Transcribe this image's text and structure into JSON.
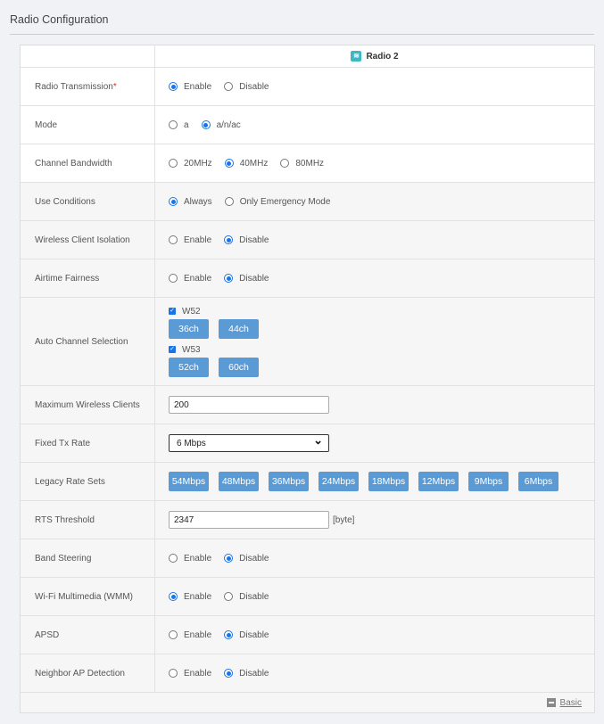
{
  "title": "Radio Configuration",
  "header": {
    "radio": "Radio 2",
    "icon": "wifi-icon",
    "icon_color": "#3bb8c4"
  },
  "rows": [
    {
      "label": "Radio Transmission",
      "required": "*",
      "type": "radio",
      "options": [
        "Enable",
        "Disable"
      ],
      "selected": 0
    },
    {
      "label": "Mode",
      "type": "radio",
      "options": [
        "a",
        "a/n/ac"
      ],
      "selected": 1
    },
    {
      "label": "Channel Bandwidth",
      "type": "radio",
      "options": [
        "20MHz",
        "40MHz",
        "80MHz"
      ],
      "selected": 1
    },
    {
      "label": "Use Conditions",
      "type": "radio",
      "options": [
        "Always",
        "Only Emergency Mode"
      ],
      "selected": 0
    },
    {
      "label": "Wireless Client Isolation",
      "type": "radio",
      "options": [
        "Enable",
        "Disable"
      ],
      "selected": 1
    },
    {
      "label": "Airtime Fairness",
      "type": "radio",
      "options": [
        "Enable",
        "Disable"
      ],
      "selected": 1
    },
    {
      "label": "Auto Channel Selection",
      "type": "channels",
      "groups": [
        {
          "name": "W52",
          "checked": true,
          "channels": [
            "36ch",
            "44ch"
          ]
        },
        {
          "name": "W53",
          "checked": true,
          "channels": [
            "52ch",
            "60ch"
          ]
        }
      ]
    },
    {
      "label": "Maximum Wireless Clients",
      "type": "input",
      "value": "200"
    },
    {
      "label": "Fixed Tx Rate",
      "type": "select",
      "value": "6 Mbps"
    },
    {
      "label": "Legacy Rate Sets",
      "type": "buttons",
      "buttons": [
        "54Mbps",
        "48Mbps",
        "36Mbps",
        "24Mbps",
        "18Mbps",
        "12Mbps",
        "9Mbps",
        "6Mbps"
      ]
    },
    {
      "label": "RTS Threshold",
      "type": "input",
      "value": "2347",
      "unit": "[byte]"
    },
    {
      "label": "Band Steering",
      "type": "radio",
      "options": [
        "Enable",
        "Disable"
      ],
      "selected": 1
    },
    {
      "label": "Wi-Fi Multimedia (WMM)",
      "type": "radio",
      "options": [
        "Enable",
        "Disable"
      ],
      "selected": 0
    },
    {
      "label": "APSD",
      "type": "radio",
      "options": [
        "Enable",
        "Disable"
      ],
      "selected": 1
    },
    {
      "label": "Neighbor AP Detection",
      "type": "radio",
      "options": [
        "Enable",
        "Disable"
      ],
      "selected": 1
    }
  ],
  "footer": {
    "link": "Basic"
  },
  "colors": {
    "accent": "#1a73e8",
    "button": "#5b9bd5"
  }
}
